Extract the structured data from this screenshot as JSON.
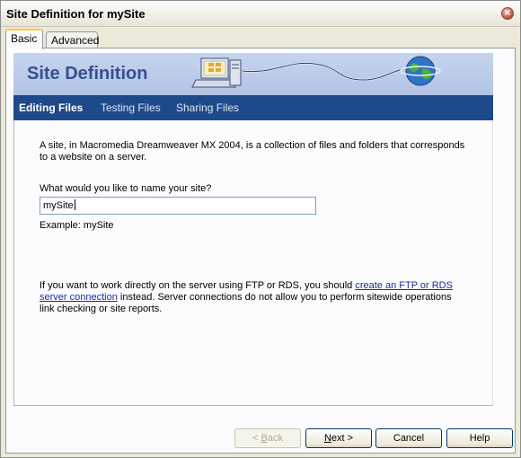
{
  "window": {
    "title": "Site Definition for mySite",
    "close_label": "×"
  },
  "tabs": [
    {
      "label": "Basic",
      "active": true
    },
    {
      "label": "Advanced",
      "active": false
    }
  ],
  "banner": {
    "heading": "Site Definition"
  },
  "nav": [
    {
      "label": "Editing Files",
      "active": true
    },
    {
      "label": "Testing Files",
      "active": false
    },
    {
      "label": "Sharing Files",
      "active": false
    }
  ],
  "intro": {
    "line1": "A site, in Macromedia Dreamweaver MX 2004, is a collection of files and folders that corresponds",
    "line2": "to a website on a server."
  },
  "name_prompt": "What would you like to name your site?",
  "site_name": {
    "value": "mySite",
    "example": "Example: mySite"
  },
  "ftp_note": {
    "line1_pre": "If you want to work directly on the server using FTP or RDS, you should ",
    "link_part1": "create an FTP or RDS",
    "link_part2": "server connection",
    "line2_post": " instead. Server connections do not allow you to perform sitewide operations",
    "line3": "link checking or site reports."
  },
  "buttons": {
    "back": {
      "prefix": "< ",
      "mnemonic": "B",
      "rest": "ack"
    },
    "next": {
      "mnemonic": "N",
      "rest": "ext >"
    },
    "cancel": "Cancel",
    "help": "Help"
  },
  "colors": {
    "banner_text": "#35508f",
    "navbar_bg": "#1e4a8c",
    "link": "#1a2d9c",
    "tab_highlight": "#ffc83c"
  },
  "icons": [
    "close-icon",
    "computer-icon",
    "globe-icon"
  ]
}
